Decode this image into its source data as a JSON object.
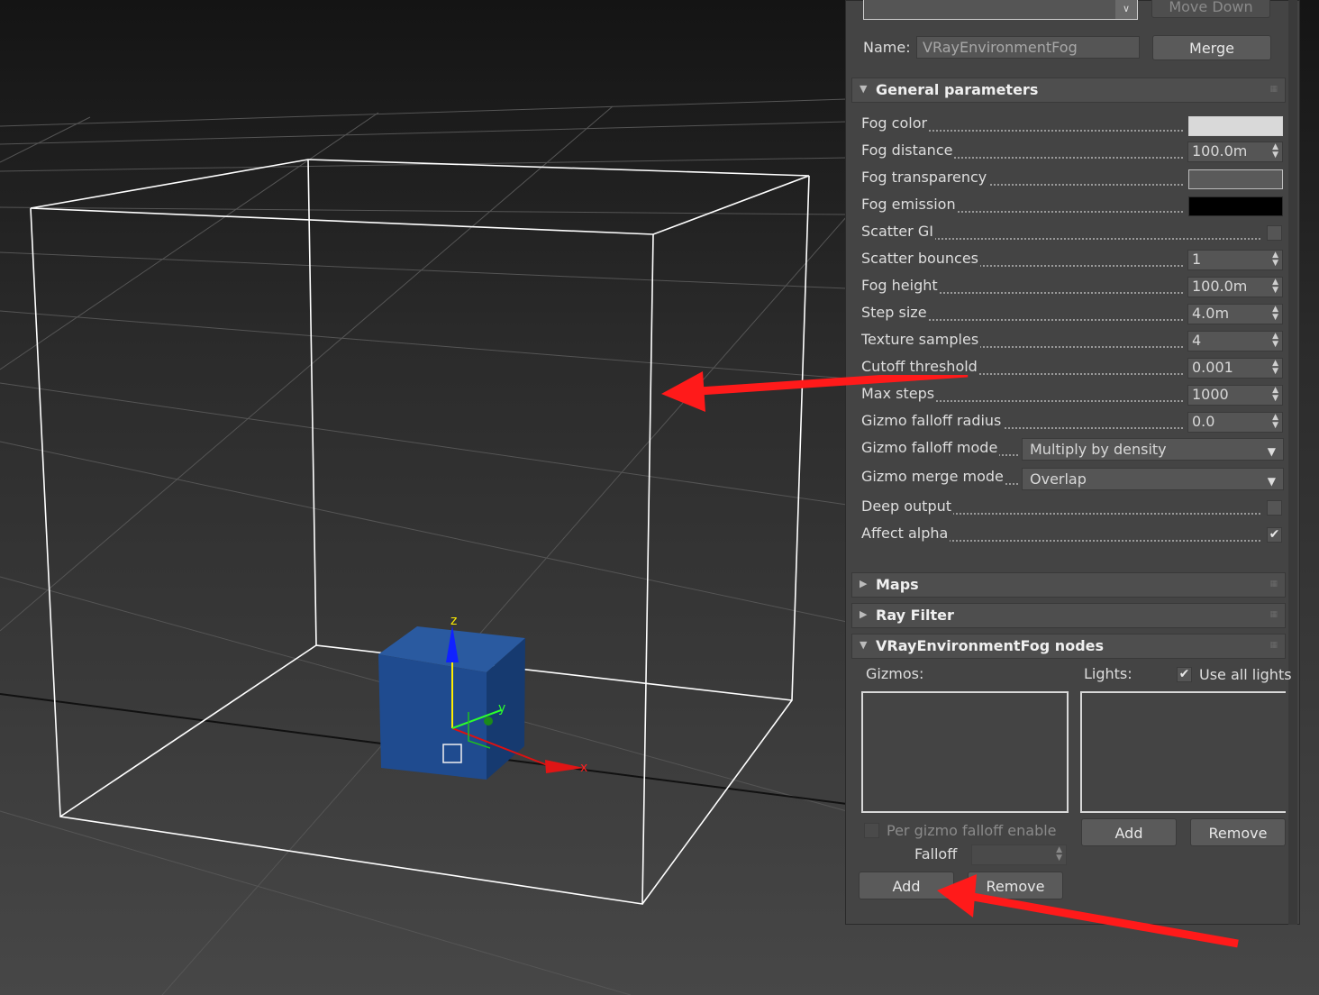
{
  "top": {
    "move_down_label": "Move Down",
    "name_label": "Name:",
    "name_value": "VRayEnvironmentFog",
    "merge_label": "Merge"
  },
  "general": {
    "title": "General parameters",
    "params": {
      "fog_color": "Fog color",
      "fog_distance": "Fog distance",
      "fog_transparency": "Fog transparency",
      "fog_emission": "Fog emission",
      "scatter_gi": "Scatter GI",
      "scatter_bounces": "Scatter bounces",
      "fog_height": "Fog height",
      "step_size": "Step size",
      "texture_samples": "Texture samples",
      "cutoff_threshold": "Cutoff threshold",
      "max_steps": "Max steps",
      "gizmo_falloff_radius": "Gizmo falloff radius",
      "gizmo_falloff_mode": "Gizmo falloff mode",
      "gizmo_merge_mode": "Gizmo merge mode",
      "deep_output": "Deep output",
      "affect_alpha": "Affect alpha"
    },
    "values": {
      "fog_distance": "100.0m",
      "scatter_bounces": "1",
      "fog_height": "100.0m",
      "step_size": "4.0m",
      "texture_samples": "4",
      "cutoff_threshold": "0.001",
      "max_steps": "1000",
      "gizmo_falloff_radius": "0.0",
      "gizmo_falloff_mode": "Multiply by density",
      "gizmo_merge_mode": "Overlap"
    },
    "colors": {
      "fog_color": "#d9d9d9",
      "fog_transparency": "#5a5a5a",
      "fog_emission": "#000000"
    },
    "checks": {
      "scatter_gi": false,
      "deep_output": false,
      "affect_alpha": true
    }
  },
  "maps": {
    "title": "Maps"
  },
  "ray_filter": {
    "title": "Ray Filter"
  },
  "nodes": {
    "title": "VRayEnvironmentFog nodes",
    "gizmos_label": "Gizmos:",
    "lights_label": "Lights:",
    "use_all_lights_label": "Use all lights",
    "use_all_lights_checked": true,
    "per_gizmo_label": "Per gizmo falloff enable",
    "falloff_label": "Falloff",
    "add_label": "Add",
    "remove_label": "Remove"
  },
  "viewport": {
    "axis_x": "x",
    "axis_y": "y",
    "axis_z": "z",
    "arrow_color": "#ff1a1a",
    "box_color": "#1f4b8f"
  }
}
